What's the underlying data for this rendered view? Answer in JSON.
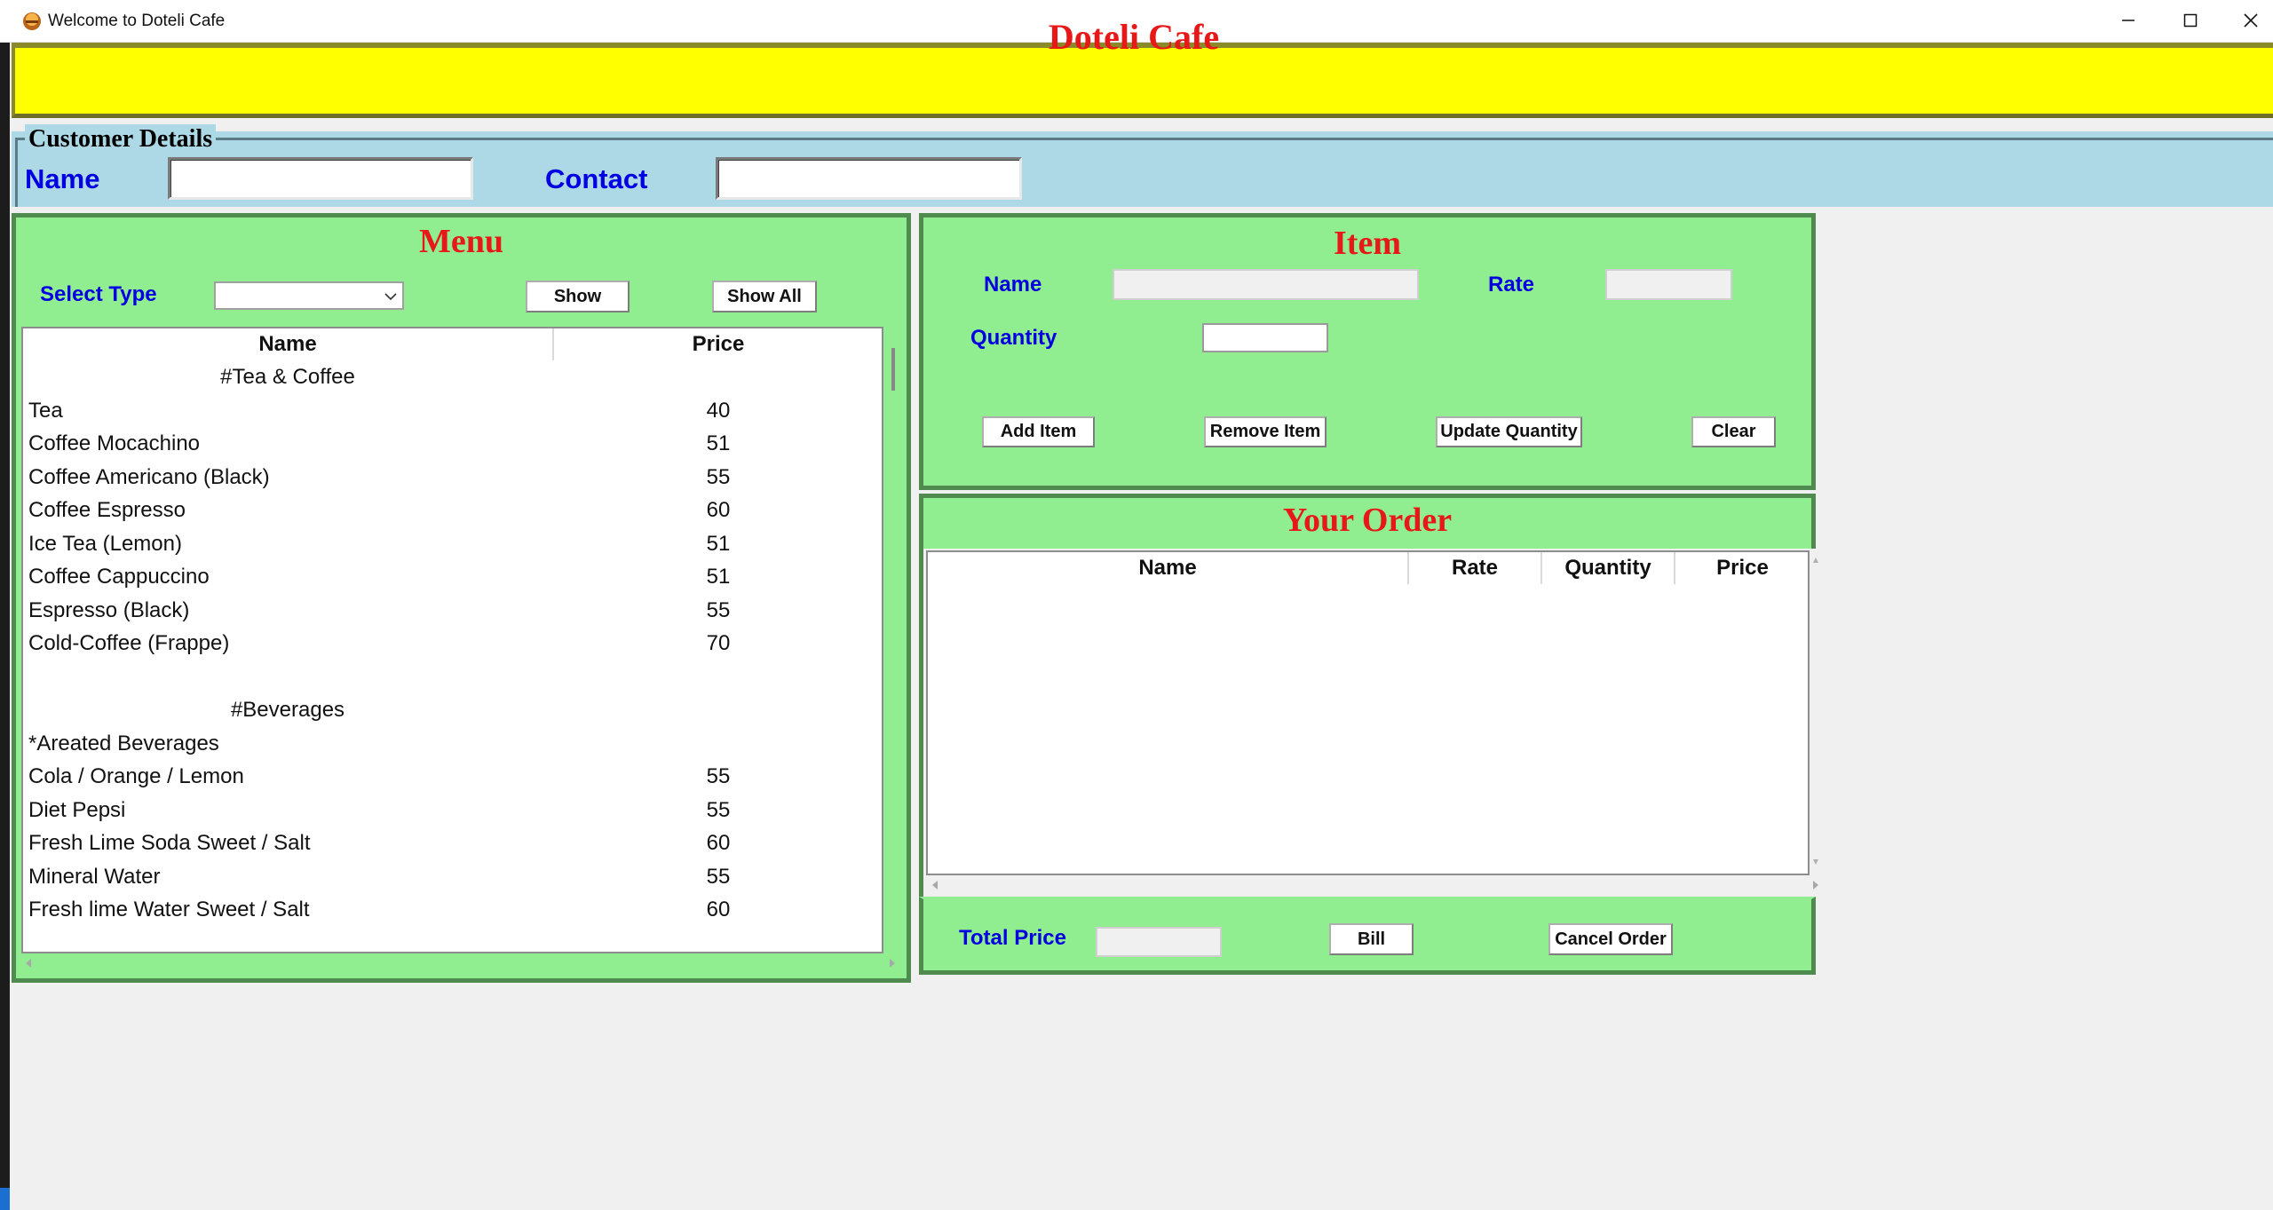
{
  "window": {
    "title": "Welcome to Doteli Cafe",
    "controls": [
      "minimize-icon",
      "maximize-icon",
      "close-icon"
    ]
  },
  "banner": {
    "title": "Doteli Cafe",
    "bg_color": "#ffff00",
    "title_color": "#e81818"
  },
  "customer": {
    "legend": "Customer Details",
    "name_label": "Name",
    "name_value": "",
    "contact_label": "Contact",
    "contact_value": "",
    "bg_color": "#add8e6"
  },
  "menu": {
    "title": "Menu",
    "select_type_label": "Select Type",
    "select_type_value": "",
    "show_button": "Show",
    "show_all_button": "Show All",
    "columns": [
      "Name",
      "Price"
    ],
    "rows": [
      {
        "name": "#Tea & Coffee",
        "price": "",
        "heading": true
      },
      {
        "name": "Tea",
        "price": "40"
      },
      {
        "name": "Coffee Mocachino",
        "price": "51"
      },
      {
        "name": "Coffee Americano (Black)",
        "price": "55"
      },
      {
        "name": "Coffee Espresso",
        "price": "60"
      },
      {
        "name": "Ice Tea (Lemon)",
        "price": "51"
      },
      {
        "name": "Coffee Cappuccino",
        "price": "51"
      },
      {
        "name": "Espresso (Black)",
        "price": "55"
      },
      {
        "name": "Cold-Coffee (Frappe)",
        "price": "70"
      },
      {
        "name": "",
        "price": ""
      },
      {
        "name": "#Beverages",
        "price": "",
        "heading": true
      },
      {
        "name": "*Areated Beverages",
        "price": ""
      },
      {
        "name": "Cola / Orange / Lemon",
        "price": "55"
      },
      {
        "name": "Diet Pepsi",
        "price": "55"
      },
      {
        "name": "Fresh Lime Soda Sweet / Salt",
        "price": "60"
      },
      {
        "name": "Mineral Water",
        "price": "55"
      },
      {
        "name": "Fresh lime Water Sweet / Salt",
        "price": "60"
      }
    ]
  },
  "item": {
    "title": "Item",
    "name_label": "Name",
    "name_value": "",
    "rate_label": "Rate",
    "rate_value": "",
    "quantity_label": "Quantity",
    "quantity_value": "",
    "add_button": "Add Item",
    "remove_button": "Remove Item",
    "update_button": "Update Quantity",
    "clear_button": "Clear"
  },
  "order": {
    "title": "Your Order",
    "columns": [
      "Name",
      "Rate",
      "Quantity",
      "Price"
    ],
    "rows": [],
    "total_label": "Total Price",
    "total_value": "",
    "bill_button": "Bill",
    "cancel_button": "Cancel Order"
  },
  "colors": {
    "frame_green": "#90ee90",
    "label_blue": "#0000e0",
    "title_red": "#e81818"
  }
}
